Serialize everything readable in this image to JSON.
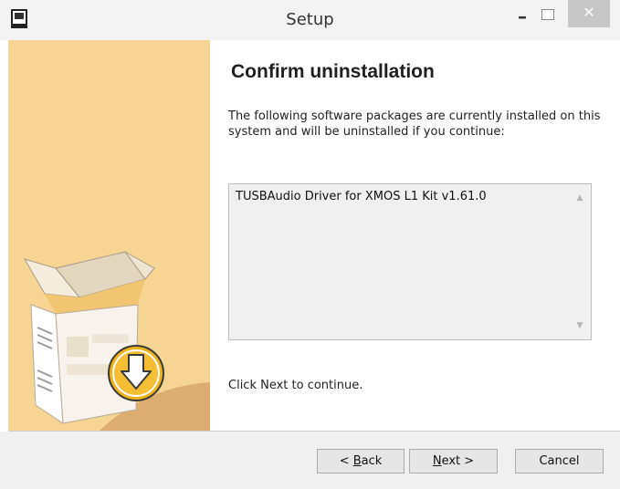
{
  "window": {
    "title": "Setup",
    "controls": {
      "minimize": "–",
      "maximize": "□",
      "close": "✕"
    }
  },
  "banner": {
    "icon": "package-uninstall-icon",
    "colors": {
      "background": "#f6d494",
      "arrow_circle": "#f0b21c"
    }
  },
  "main": {
    "heading": "Confirm uninstallation",
    "description": "The following software packages are currently installed on this system and will be uninstalled if you continue:",
    "packages": [
      "TUSBAudio Driver for XMOS L1 Kit v1.61.0"
    ],
    "footer_note": "Click Next to continue."
  },
  "footer": {
    "back": {
      "mnemonic": "B",
      "rest": "ack",
      "prefix": "< "
    },
    "next": {
      "mnemonic": "N",
      "rest": "ext",
      "suffix": " >"
    },
    "cancel": "Cancel"
  }
}
